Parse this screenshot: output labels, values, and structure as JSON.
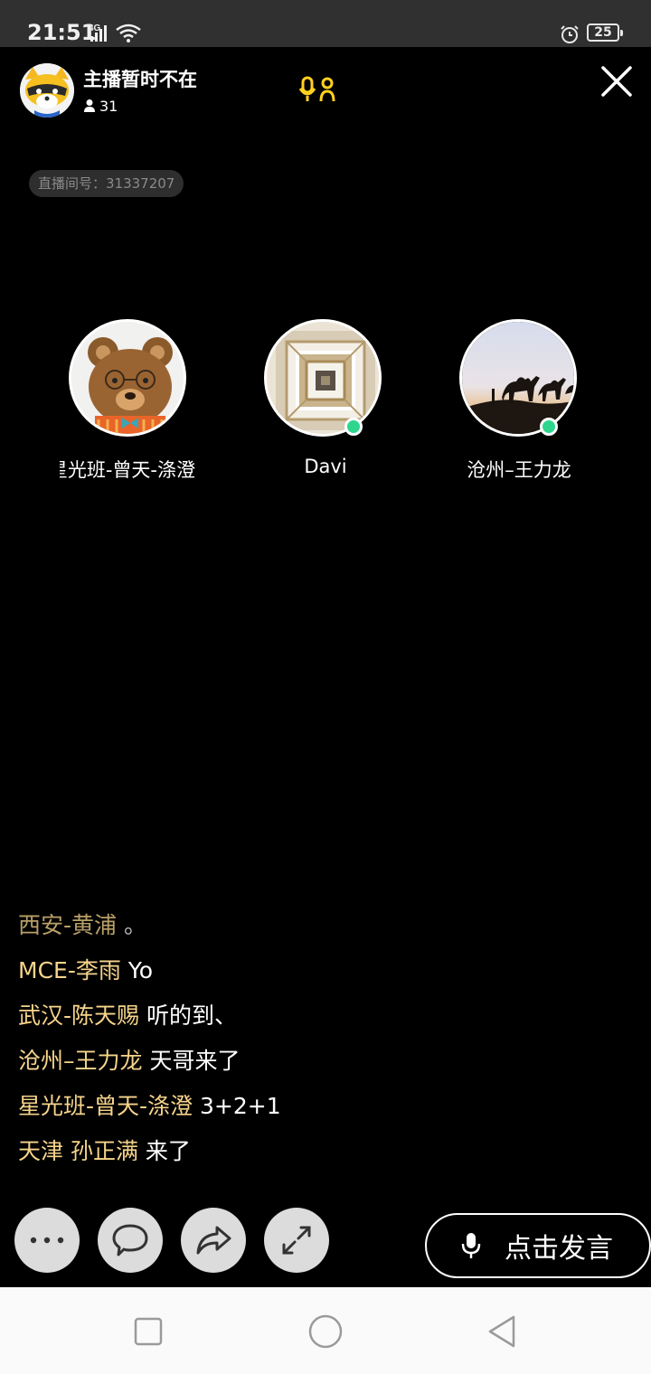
{
  "status_bar": {
    "time": "21:51",
    "network": "4G",
    "battery": "25",
    "icons": [
      "signal-icon",
      "wifi-icon",
      "alarm-icon",
      "battery-icon"
    ]
  },
  "header": {
    "host_status": "主播暂时不在",
    "viewer_count": "31",
    "room_id": "直播间号：31337207"
  },
  "guests": [
    {
      "name": "星光班-曾天-涤澄",
      "online": false
    },
    {
      "name": "Davi",
      "online": true
    },
    {
      "name": "沧州–王力龙",
      "online": true
    }
  ],
  "chat": [
    {
      "user": "西安-黄浦",
      "message": "。"
    },
    {
      "user": "MCE-李雨",
      "message": "Yo"
    },
    {
      "user": "武汉-陈天赐",
      "message": "听的到、"
    },
    {
      "user": "沧州–王力龙",
      "message": "天哥来了"
    },
    {
      "user": "星光班-曾天-涤澄",
      "message": "3+2+1"
    },
    {
      "user": "天津 孙正满",
      "message": "来了"
    }
  ],
  "bottom": {
    "speak_label": "点击发言",
    "buttons": [
      "more-icon",
      "comment-icon",
      "share-icon",
      "fullscreen-icon"
    ]
  },
  "colors": {
    "background": "#000000",
    "username": "#f6d48b",
    "accent": "#ffd21f",
    "online": "#2ed58d"
  }
}
